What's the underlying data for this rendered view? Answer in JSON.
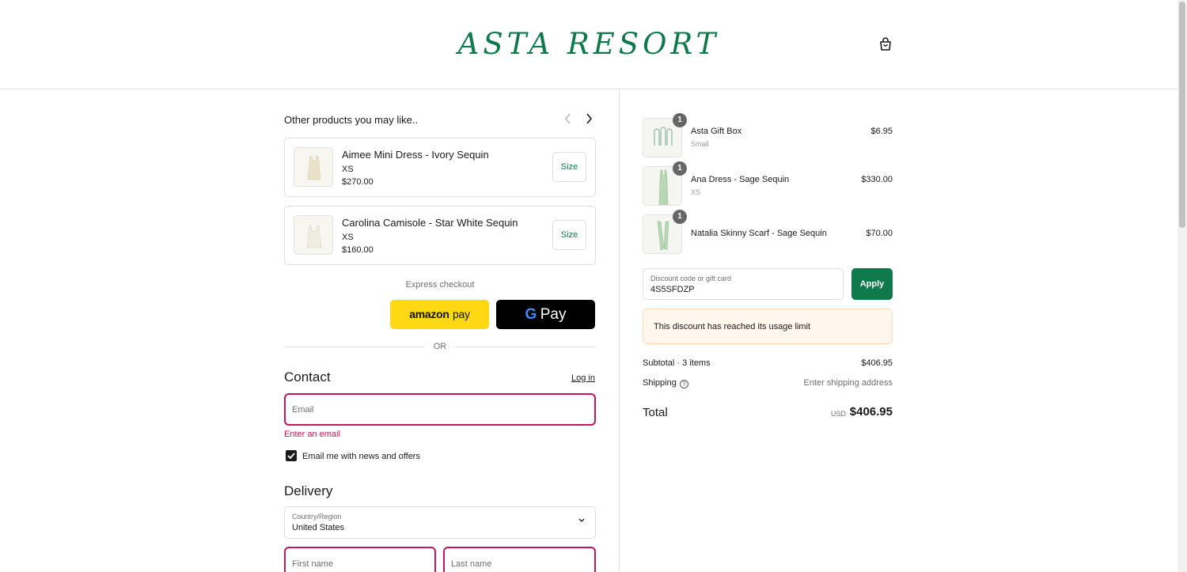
{
  "header": {
    "logo": "ASTA RESORT",
    "cart_icon": "shopping-bag-icon"
  },
  "upsell": {
    "title": "Other products you may like..",
    "prev_icon": "chevron-left-icon",
    "next_icon": "chevron-right-icon",
    "items": [
      {
        "name": "Aimee Mini Dress - Ivory Sequin",
        "variant": "XS",
        "price": "$270.00",
        "button": "Size"
      },
      {
        "name": "Carolina Camisole - Star White Sequin",
        "variant": "XS",
        "price": "$160.00",
        "button": "Size"
      }
    ]
  },
  "express": {
    "label": "Express checkout",
    "amazon_word": "amazon",
    "amazon_pay": "pay",
    "google_g": "G",
    "google_pay": "Pay",
    "or": "OR"
  },
  "contact": {
    "title": "Contact",
    "login": "Log in",
    "email_placeholder": "Email",
    "email_error": "Enter an email",
    "newsletter_label": "Email me with news and offers",
    "newsletter_checked": true
  },
  "delivery": {
    "title": "Delivery",
    "country_label": "Country/Region",
    "country_value": "United States",
    "first_name_placeholder": "First name",
    "last_name_placeholder": "Last name"
  },
  "order": {
    "items": [
      {
        "qty": "1",
        "name": "Asta Gift Box",
        "variant": "Small",
        "price": "$6.95"
      },
      {
        "qty": "1",
        "name": "Ana Dress - Sage Sequin",
        "variant": "XS",
        "price": "$330.00"
      },
      {
        "qty": "1",
        "name": "Natalia Skinny Scarf - Sage Sequin",
        "variant": "",
        "price": "$70.00"
      }
    ],
    "discount_label": "Discount code or gift card",
    "discount_value": "4S5SFDZP",
    "apply": "Apply",
    "notice": "This discount has reached its usage limit",
    "subtotal_label": "Subtotal · 3 items",
    "subtotal_value": "$406.95",
    "shipping_label": "Shipping",
    "shipping_value": "Enter shipping address",
    "total_label": "Total",
    "total_currency": "USD",
    "total_value": "$406.95"
  },
  "colors": {
    "brand": "#0e7a4b",
    "error": "#c2185b",
    "amazon": "#ffd814",
    "notice_bg": "#fff6ed"
  }
}
